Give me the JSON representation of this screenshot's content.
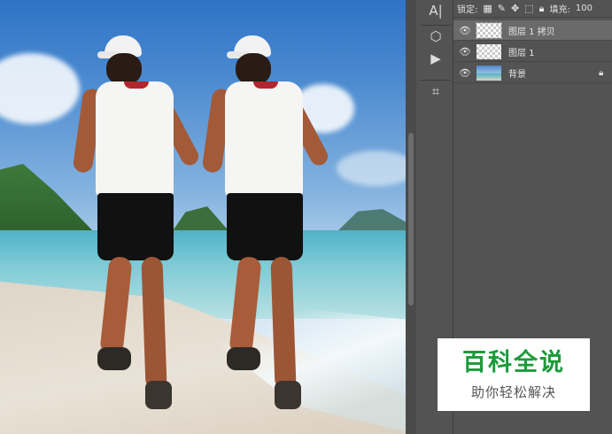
{
  "toolbar": {
    "tools": [
      {
        "name": "character-tool",
        "glyph": "A|"
      },
      {
        "name": "3d-icon",
        "glyph": "⬡"
      },
      {
        "name": "play-icon",
        "glyph": "▶"
      },
      {
        "name": "crop-icon",
        "glyph": "⌗"
      }
    ]
  },
  "lock_bar": {
    "lock_label": "锁定:",
    "fill_label": "填充:",
    "fill_value": "100"
  },
  "layers": [
    {
      "name": "图层 1 拷贝",
      "selected": true,
      "thumbnail": "transparent-outlined"
    },
    {
      "name": "图层 1",
      "selected": false,
      "thumbnail": "transparent"
    },
    {
      "name": "背景",
      "selected": false,
      "thumbnail": "photo",
      "locked": true
    }
  ],
  "watermark": {
    "title": "百科全说",
    "subtitle": "助你轻松解决"
  },
  "colors": {
    "panel_bg": "#535353",
    "selected_row": "#6a6a6a",
    "watermark_green": "#1d9a3a"
  }
}
